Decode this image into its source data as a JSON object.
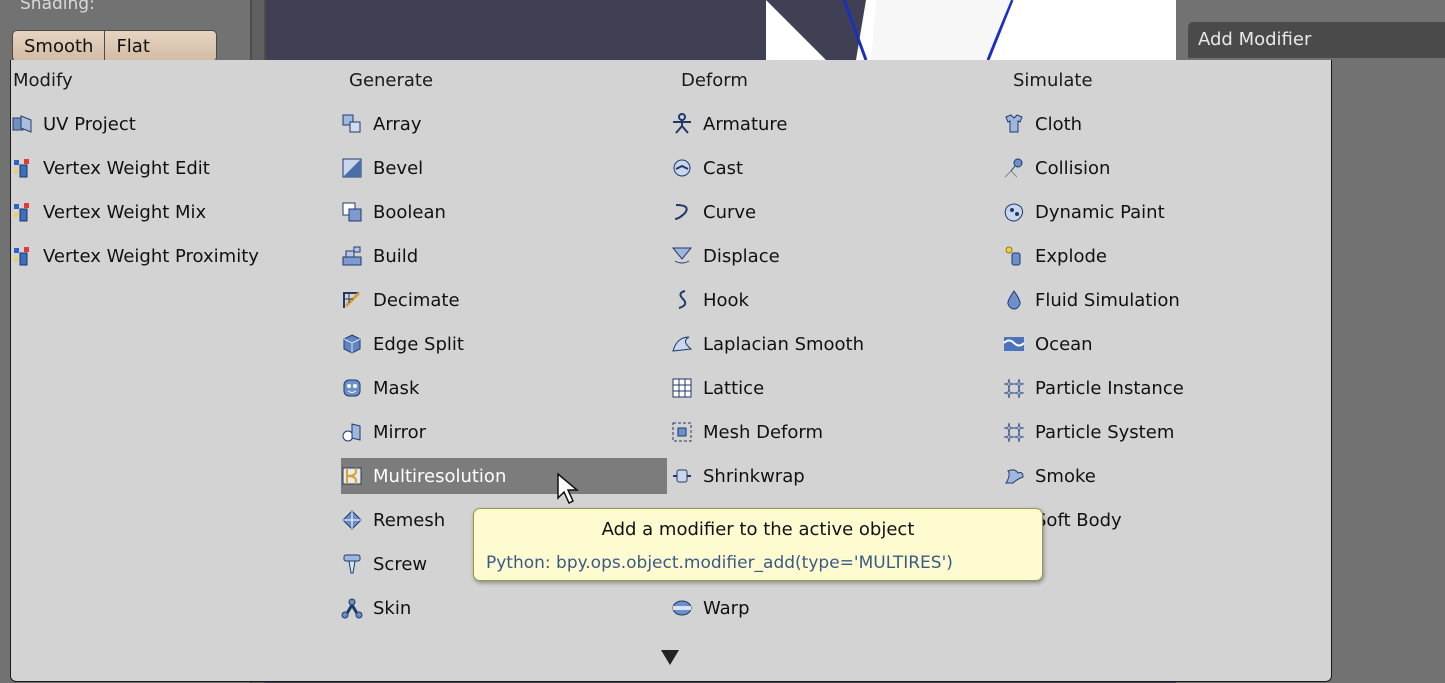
{
  "background": {
    "shading_label": "Shading:",
    "shading_buttons": [
      "Smooth",
      "Flat"
    ],
    "add_modifier_label": "Add Modifier"
  },
  "menu": {
    "columns": [
      {
        "header": "Modify",
        "items": [
          {
            "label": "UV Project",
            "icon": "uv-project-icon"
          },
          {
            "label": "Vertex Weight Edit",
            "icon": "vertex-weight-icon"
          },
          {
            "label": "Vertex Weight Mix",
            "icon": "vertex-weight-icon"
          },
          {
            "label": "Vertex Weight Proximity",
            "icon": "vertex-weight-icon"
          }
        ]
      },
      {
        "header": "Generate",
        "items": [
          {
            "label": "Array",
            "icon": "array-icon"
          },
          {
            "label": "Bevel",
            "icon": "bevel-icon"
          },
          {
            "label": "Boolean",
            "icon": "boolean-icon"
          },
          {
            "label": "Build",
            "icon": "build-icon"
          },
          {
            "label": "Decimate",
            "icon": "decimate-icon"
          },
          {
            "label": "Edge Split",
            "icon": "edge-split-icon"
          },
          {
            "label": "Mask",
            "icon": "mask-icon"
          },
          {
            "label": "Mirror",
            "icon": "mirror-icon"
          },
          {
            "label": "Multiresolution",
            "icon": "multiresolution-icon",
            "highlighted": true
          },
          {
            "label": "Remesh",
            "icon": "remesh-icon"
          },
          {
            "label": "Screw",
            "icon": "screw-icon"
          },
          {
            "label": "Skin",
            "icon": "skin-icon"
          }
        ]
      },
      {
        "header": "Deform",
        "items": [
          {
            "label": "Armature",
            "icon": "armature-icon"
          },
          {
            "label": "Cast",
            "icon": "cast-icon"
          },
          {
            "label": "Curve",
            "icon": "curve-icon"
          },
          {
            "label": "Displace",
            "icon": "displace-icon"
          },
          {
            "label": "Hook",
            "icon": "hook-icon"
          },
          {
            "label": "Laplacian Smooth",
            "icon": "laplacian-smooth-icon"
          },
          {
            "label": "Lattice",
            "icon": "lattice-icon"
          },
          {
            "label": "Mesh Deform",
            "icon": "mesh-deform-icon"
          },
          {
            "label": "Shrinkwrap",
            "icon": "shrinkwrap-icon"
          },
          {
            "label": "",
            "icon": ""
          },
          {
            "label": "",
            "icon": ""
          },
          {
            "label": "Warp",
            "icon": "warp-icon"
          }
        ]
      },
      {
        "header": "Simulate",
        "items": [
          {
            "label": "Cloth",
            "icon": "cloth-icon"
          },
          {
            "label": "Collision",
            "icon": "collision-icon"
          },
          {
            "label": "Dynamic Paint",
            "icon": "dynamic-paint-icon"
          },
          {
            "label": "Explode",
            "icon": "explode-icon"
          },
          {
            "label": "Fluid Simulation",
            "icon": "fluid-simulation-icon"
          },
          {
            "label": "Ocean",
            "icon": "ocean-icon"
          },
          {
            "label": "Particle Instance",
            "icon": "particle-instance-icon"
          },
          {
            "label": "Particle System",
            "icon": "particle-system-icon"
          },
          {
            "label": "Smoke",
            "icon": "smoke-icon"
          },
          {
            "label": "Soft Body",
            "icon": "soft-body-icon"
          }
        ]
      }
    ]
  },
  "tooltip": {
    "text": "Add a modifier to the active object",
    "python": "Python: bpy.ops.object.modifier_add(type='MULTIRES')"
  },
  "colors": {
    "menu_bg": "#d3d3d3",
    "highlight": "#7c7c7c",
    "tooltip_bg": "#fffbd1",
    "icon_blue": "#2c4a7a"
  }
}
